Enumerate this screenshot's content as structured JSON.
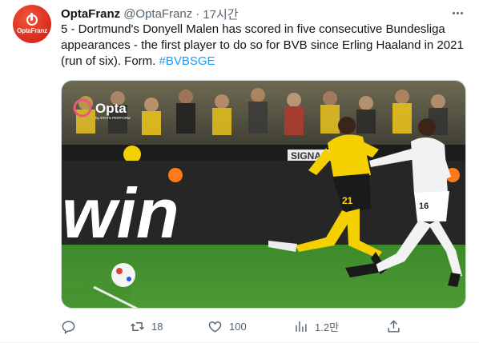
{
  "author": {
    "name": "OptaFranz",
    "handle": "@OptaFranz",
    "separator": "·",
    "time": "17시간",
    "avatar_text": "OptaFranz"
  },
  "tweet": {
    "text": "5 - Dortmund's Donyell Malen has scored in five consecutive Bundesliga appearances - the first player to do so for BVB since Erling Haaland in 2021 (run of six). Form. ",
    "hashtag": "#BVBSGE"
  },
  "media": {
    "watermark_brand": "Opta",
    "watermark_sub": "by STATS PERFORM",
    "board_text": "win",
    "sign_text": "SIGNA",
    "left_player_number": "21",
    "right_player_number": "16",
    "description_icon": "football-photo"
  },
  "actions": {
    "reply_count": "",
    "retweet_count": "18",
    "like_count": "100",
    "views_count": "1.2만",
    "share_count": ""
  },
  "colors": {
    "link": "#1d9bf0",
    "muted": "#536471",
    "brand": "#e0301e",
    "pitch": "#3f8a2e",
    "bvb_yellow": "#f5d000"
  }
}
